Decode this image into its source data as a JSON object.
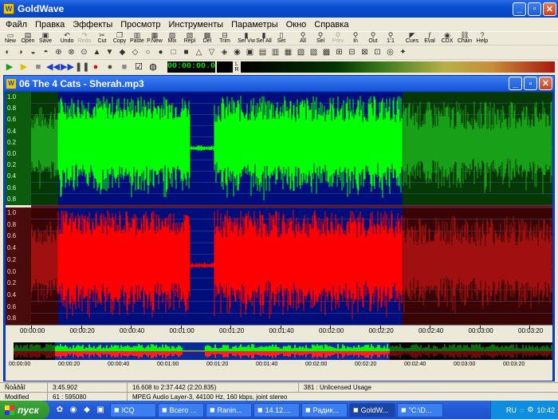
{
  "app": {
    "title": "GoldWave",
    "icon_letter": "W"
  },
  "menu": [
    "Файл",
    "Правка",
    "Эффекты",
    "Просмотр",
    "Инструменты",
    "Параметры",
    "Окно",
    "Справка"
  ],
  "toolbar": [
    {
      "label": "New",
      "icon": "new-file-icon",
      "glyph": "▭",
      "enabled": true
    },
    {
      "label": "Open",
      "icon": "open-folder-icon",
      "glyph": "▤",
      "enabled": true
    },
    {
      "label": "Save",
      "icon": "save-disk-icon",
      "glyph": "▣",
      "enabled": true
    },
    {
      "sep": true
    },
    {
      "label": "Undo",
      "icon": "undo-icon",
      "glyph": "↶",
      "enabled": true
    },
    {
      "label": "Redo",
      "icon": "redo-icon",
      "glyph": "↷",
      "enabled": false
    },
    {
      "label": "Cut",
      "icon": "cut-icon",
      "glyph": "✂",
      "enabled": true
    },
    {
      "label": "Copy",
      "icon": "copy-icon",
      "glyph": "❐",
      "enabled": true
    },
    {
      "label": "Paste",
      "icon": "paste-icon",
      "glyph": "▥",
      "enabled": true
    },
    {
      "label": "P.New",
      "icon": "paste-new-icon",
      "glyph": "▦",
      "enabled": true
    },
    {
      "label": "Mix",
      "icon": "mix-icon",
      "glyph": "▧",
      "enabled": true
    },
    {
      "label": "Repl",
      "icon": "replace-icon",
      "glyph": "▨",
      "enabled": true
    },
    {
      "label": "Del",
      "icon": "delete-icon",
      "glyph": "▩",
      "enabled": true
    },
    {
      "label": "Trim",
      "icon": "trim-icon",
      "glyph": "⊟",
      "enabled": true
    },
    {
      "sep": true
    },
    {
      "label": "Sel Vw",
      "icon": "select-view-icon",
      "glyph": "▮",
      "enabled": true
    },
    {
      "label": "Sel All",
      "icon": "select-all-icon",
      "glyph": "▮",
      "enabled": true
    },
    {
      "label": "Set",
      "icon": "set-icon",
      "glyph": "▯",
      "enabled": true
    },
    {
      "sep": true
    },
    {
      "label": "All",
      "icon": "zoom-all-icon",
      "glyph": "⚲",
      "enabled": true
    },
    {
      "label": "Sel",
      "icon": "zoom-selection-icon",
      "glyph": "⚲",
      "enabled": true
    },
    {
      "label": "Prev",
      "icon": "zoom-prev-icon",
      "glyph": "⚲",
      "enabled": false
    },
    {
      "label": "In",
      "icon": "zoom-in-icon",
      "glyph": "⚲",
      "enabled": true
    },
    {
      "label": "Out",
      "icon": "zoom-out-icon",
      "glyph": "⚲",
      "enabled": true
    },
    {
      "label": "1:1",
      "icon": "zoom-1-1-icon",
      "glyph": "⚲",
      "enabled": true
    },
    {
      "sep": true
    },
    {
      "label": "Cues",
      "icon": "cues-icon",
      "glyph": "◤",
      "enabled": true
    },
    {
      "label": "Eval",
      "icon": "eval-icon",
      "glyph": "ƒ",
      "enabled": true
    },
    {
      "label": "CDX",
      "icon": "cdx-icon",
      "glyph": "◉",
      "enabled": true
    },
    {
      "label": "Chain",
      "icon": "chain-icon",
      "glyph": "⛓",
      "enabled": true
    },
    {
      "label": "Help",
      "icon": "help-book-icon",
      "glyph": "?",
      "enabled": true
    }
  ],
  "toolbar2_icons": [
    "effect-icon-1",
    "effect-icon-2",
    "effect-icon-3",
    "effect-icon-4",
    "effect-icon-5",
    "effect-icon-6",
    "effect-icon-7",
    "effect-icon-8",
    "effect-icon-9",
    "effect-icon-10",
    "effect-icon-11",
    "effect-icon-12",
    "effect-icon-13",
    "effect-icon-14",
    "effect-icon-15",
    "effect-icon-16",
    "effect-icon-17",
    "effect-icon-18",
    "effect-icon-19",
    "effect-icon-20",
    "effect-icon-21",
    "effect-icon-22",
    "effect-icon-23",
    "effect-icon-24",
    "effect-icon-25",
    "effect-icon-26",
    "effect-icon-27",
    "effect-icon-28",
    "effect-icon-29",
    "effect-icon-30",
    "effect-icon-31",
    "effect-icon-32"
  ],
  "transport": {
    "buttons": [
      {
        "name": "play-icon",
        "glyph": "▶",
        "color": "#1a9a1a"
      },
      {
        "name": "play-selection-icon",
        "glyph": "▶",
        "color": "#e0c000"
      },
      {
        "name": "stop-icon",
        "glyph": "■",
        "color": "#888888"
      },
      {
        "name": "rewind-icon",
        "glyph": "◀◀",
        "color": "#1a3ac8"
      },
      {
        "name": "fast-forward-icon",
        "glyph": "▶▶",
        "color": "#1a3ac8"
      },
      {
        "name": "pause-icon",
        "glyph": "❚❚",
        "color": "#444444"
      },
      {
        "name": "record-icon",
        "glyph": "●",
        "color": "#d01010"
      },
      {
        "name": "record-selection-icon",
        "glyph": "●",
        "color": "#444444"
      },
      {
        "name": "monitor-icon",
        "glyph": "■",
        "color": "#888888"
      },
      {
        "name": "check-icon",
        "glyph": "☑",
        "color": "#000000"
      },
      {
        "name": "device-icon",
        "glyph": "◍",
        "color": "#000000"
      }
    ],
    "counter": "00:00:00.0"
  },
  "document": {
    "title": "06 The 4 Cats - Sherah.mp3"
  },
  "waveform": {
    "top_color": "#00ff00",
    "bottom_color": "#ff0000",
    "y_ticks": [
      "1.0",
      "0.8",
      "0.6",
      "0.4",
      "0.2",
      "0.0",
      "0.2",
      "0.4",
      "0.6",
      "0.8"
    ],
    "time_labels": [
      "00:00:00",
      "00:00:20",
      "00:00:40",
      "00:01:00",
      "00:01:20",
      "00:01:40",
      "00:02:00",
      "00:02:20",
      "00:02:40",
      "00:03:00",
      "00:03:20"
    ],
    "overview_labels": [
      "00:00:00",
      "00:00:20",
      "00:00:40",
      "00:01:00",
      "00:01:20",
      "00:01:40",
      "00:02:00",
      "00:02:20",
      "00:02:40",
      "00:03:00",
      "00:03:20"
    ]
  },
  "status": {
    "row1": [
      "Ñòåðåî",
      "3:45.902",
      "16.608 to 2:37.442 (2:20.835)",
      "381 : Unlicensed Usage"
    ],
    "row2": [
      "Modified",
      "61 : 595080",
      "MPEG Audio Layer-3, 44100 Hz, 160 kbps, joint stereo"
    ]
  },
  "taskbar": {
    "start": "пуск",
    "tasks": [
      "ICQ",
      "Всего ...",
      "Ranin...",
      "14.12....",
      "Радик...",
      "GoldW...",
      "\"C:\\D..."
    ],
    "active_task": 5,
    "lang": "RU",
    "clock": "10:42"
  }
}
